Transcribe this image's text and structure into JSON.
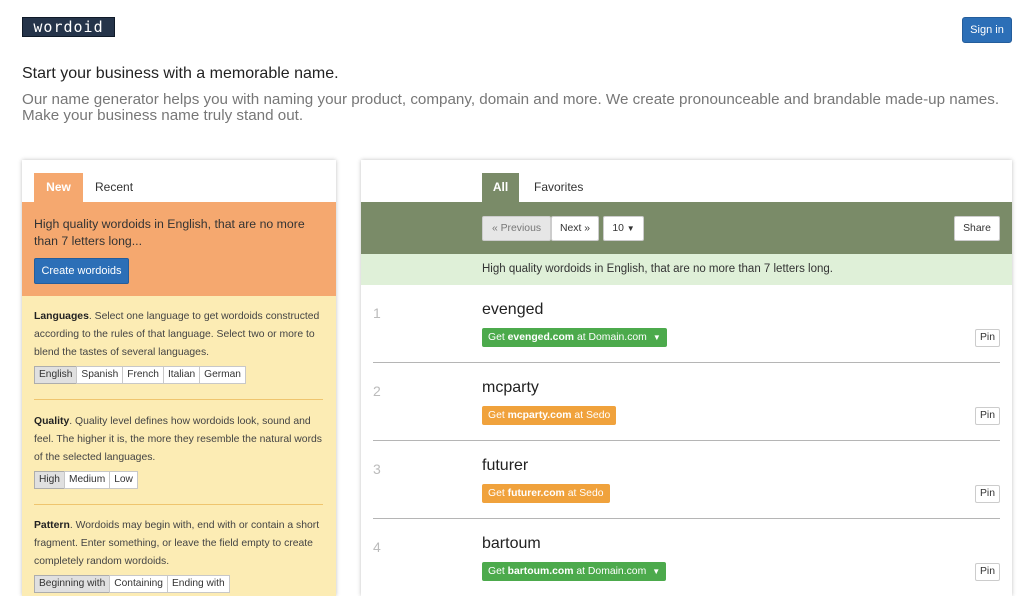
{
  "header": {
    "logo_text": "wordoid",
    "signin_label": "Sign in",
    "headline": "Start your business with a memorable name.",
    "subline": "Our name generator helps you with naming your product, company, domain and more. We create pronounceable and brandable made-up names. Make your business name truly stand out."
  },
  "left": {
    "tabs": [
      {
        "label": "New"
      },
      {
        "label": "Recent"
      }
    ],
    "banner_text": "High quality wordoids in English, that are no more than 7 letters long...",
    "create_label": "Create wordoids",
    "languages": {
      "title": "Languages",
      "desc": ". Select one language to get wordoids constructed according to the rules of that language. Select two or more to blend the tastes of several languages.",
      "options": [
        "English",
        "Spanish",
        "French",
        "Italian",
        "German"
      ]
    },
    "quality": {
      "title": "Quality",
      "desc": ". Quality level defines how wordoids look, sound and feel. The higher it is, the more they resemble the natural words of the selected languages.",
      "options": [
        "High",
        "Medium",
        "Low"
      ]
    },
    "pattern": {
      "title": "Pattern",
      "desc": ". Wordoids may begin with, end with or contain a short fragment. Enter something, or leave the field empty to create completely random wordoids.",
      "options": [
        "Beginning with",
        "Containing",
        "Ending with"
      ]
    }
  },
  "right": {
    "tabs": [
      {
        "label": "All"
      },
      {
        "label": "Favorites"
      }
    ],
    "prev_label": "« Previous",
    "next_label": "Next »",
    "count_label": "10",
    "share_label": "Share",
    "banner_text": "High quality wordoids in English, that are no more than 7 letters long.",
    "pin_label": "Pin",
    "results": [
      {
        "num": "1",
        "name": "evenged",
        "pre": "Get ",
        "domain": "evenged.com",
        "post": " at Domain.com",
        "color": "#4caa4c"
      },
      {
        "num": "2",
        "name": "mcparty",
        "pre": "Get ",
        "domain": "mcparty.com",
        "post": " at Sedo",
        "color": "#f0a23c"
      },
      {
        "num": "3",
        "name": "futurer",
        "pre": "Get ",
        "domain": "futurer.com",
        "post": " at Sedo",
        "color": "#f0a23c"
      },
      {
        "num": "4",
        "name": "bartoum",
        "pre": "Get ",
        "domain": "bartoum.com",
        "post": " at Domain.com",
        "color": "#4caa4c"
      }
    ]
  },
  "colors": {
    "accent_blue": "#2c6fb7",
    "orange": "#f5a86f",
    "olive": "#7a8b68",
    "yellow_bg": "#fcecb4",
    "green_bg": "#dff0d8"
  }
}
